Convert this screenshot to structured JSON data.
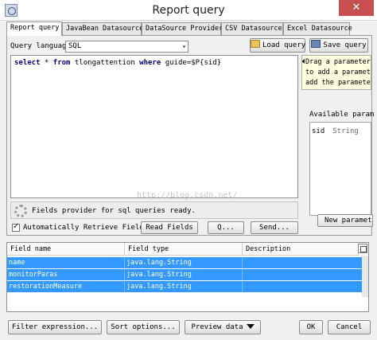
{
  "window": {
    "title": "Report query",
    "close_glyph": "✕"
  },
  "tabs": [
    {
      "label": "Report query",
      "active": true
    },
    {
      "label": "JavaBean Datasource",
      "active": false
    },
    {
      "label": "DataSource Provider",
      "active": false
    },
    {
      "label": "CSV Datasource",
      "active": false
    },
    {
      "label": "Excel Datasource",
      "active": false
    }
  ],
  "query": {
    "language_label": "Query language",
    "language_value": "SQL",
    "load_button": "Load query",
    "save_button": "Save query",
    "text_tokens": [
      "select",
      "*",
      "from",
      "tlongattention",
      "where",
      "guide=$P{sid}"
    ],
    "watermark": "http://blog.csdn.net/"
  },
  "status": {
    "message": "Fields provider for sql queries ready.",
    "auto_retrieve_label": "Automatically Retrieve Fields",
    "auto_retrieve_checked": true,
    "read_fields_button": "Read Fields",
    "q_button": "Q...",
    "send_button": "Send..."
  },
  "parameters": {
    "hint_lines": [
      "Drag a parameter",
      "to add a paramet",
      "add the paramete"
    ],
    "available_title": "Available param",
    "items": [
      {
        "name": "sid",
        "type": "String"
      }
    ],
    "new_button": "New parameter"
  },
  "fields_table": {
    "columns": [
      "Field name",
      "Field type",
      "Description"
    ],
    "rows": [
      {
        "name": "name",
        "type": "java.lang.String",
        "description": ""
      },
      {
        "name": "monitorParas",
        "type": "java.lang.String",
        "description": ""
      },
      {
        "name": "restorationMeasure",
        "type": "java.lang.String",
        "description": ""
      }
    ]
  },
  "footer": {
    "filter_button": "Filter expression...",
    "sort_button": "Sort options...",
    "preview_button": "Preview data",
    "ok_button": "OK",
    "cancel_button": "Cancel"
  },
  "colors": {
    "selection": "#3399ff",
    "close": "#c75050",
    "keyword": "#00007f",
    "hint_bg": "#ffffe1"
  },
  "icons": [
    "app-icon",
    "close-icon",
    "folder-open-icon",
    "save-icon",
    "spinner-icon",
    "checkmark-icon",
    "column-chooser-icon",
    "chevron-down-icon",
    "triangle-down-icon"
  ]
}
